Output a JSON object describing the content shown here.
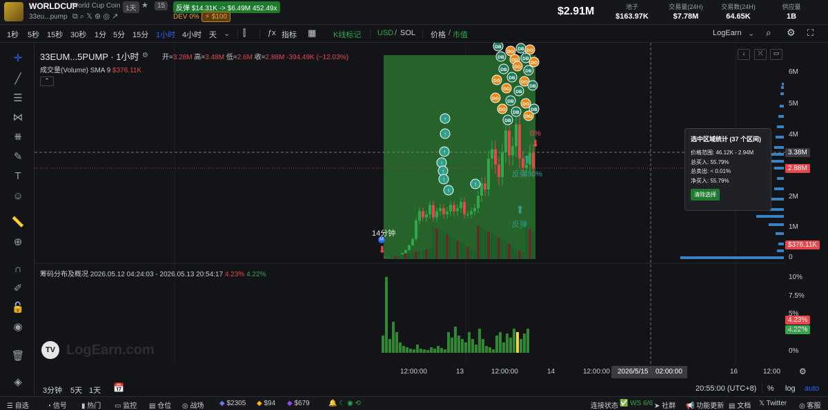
{
  "header": {
    "symbol": "WORLDCUP",
    "name": "World Cup Coin",
    "age": "1天",
    "star_count": "15",
    "address": "33eu...pump",
    "rebound": "反弹",
    "rebound_range": "$14.31K -> $6.49M",
    "rebound_pct": "452.49x",
    "dev": "DEV 0%",
    "bounty": "$100",
    "market_cap": "$2.91M",
    "stats": [
      {
        "label": "池子",
        "value": "$163.97K"
      },
      {
        "label": "交易量(24H)",
        "value": "$7.78M"
      },
      {
        "label": "交易数(24H)",
        "value": "64.65K"
      },
      {
        "label": "供应量",
        "value": "1B"
      }
    ]
  },
  "toolbar": {
    "intervals": [
      "1秒",
      "5秒",
      "15秒",
      "30秒",
      "1分",
      "5分",
      "15分",
      "1小时",
      "4小时",
      "天"
    ],
    "active_interval": "1小时",
    "indicators": "指标",
    "kline_mark": "K线标记",
    "usd": "USD",
    "sol": "SOL",
    "price": "价格",
    "mcap": "市值",
    "logearn": "LogEarn"
  },
  "legend": {
    "title": "33EUM...5PUMP · 1小时",
    "open_label": "开=",
    "open": "3.28M",
    "high_label": "高=",
    "high": "3.48M",
    "low_label": "低=",
    "low": "2.6M",
    "close_label": "收=",
    "close": "2.88M",
    "change": "-394.49K (−12.03%)",
    "volume": "成交量(Volume) SMA 9",
    "volume_value": "$376.11K",
    "chips": "筹码分布及概况 2026.05.12 04:24:03 - 2026.05.13 20:54:17",
    "chips_red": "4.23%",
    "chips_green": "4.22%"
  },
  "markers": {
    "m14": "14分钟",
    "m": "M",
    "rebound": "反弹",
    "rebound30": "反弹30%",
    "red_pct": "0%"
  },
  "popup": {
    "title": "选中区域统计 (37 个区间)",
    "range": "价格范围: 46.12K - 2.94M",
    "buy": "总买入: 55.79%",
    "sell": "总卖出: < 0.01%",
    "net": "净买入: 55.79%",
    "clear": "清除选择"
  },
  "yaxis": {
    "top_labels": [
      "6M",
      "5M",
      "4M",
      "2M",
      "1M",
      "0"
    ],
    "badge_3": "3.38M",
    "badge_2": "2.88M",
    "badge_vol": "$376.11K",
    "bottom_labels": [
      "10%",
      "7.5%",
      "5%",
      "2.5%",
      "0%"
    ],
    "badge_red": "4.23%",
    "badge_green": "4.22%"
  },
  "xaxis": {
    "labels": [
      "12:00:00",
      "13",
      "12:00:00",
      "14",
      "12:00:00",
      "16",
      "12:00"
    ],
    "crosshair": "2026/5/15",
    "crosshair_time": "02:00:00"
  },
  "bottombar": {
    "ranges": [
      "3分钟",
      "5天",
      "1天"
    ],
    "clock": "20:55:00 (UTC+8)",
    "pct": "%",
    "log": "log",
    "auto": "auto"
  },
  "watermark": "LogEarn.com",
  "footer": {
    "left": [
      "自选",
      "信号",
      "热门",
      "监控",
      "仓位",
      "战场"
    ],
    "eth": "$2305",
    "bnb": "$94",
    "sol": "$679",
    "conn": "连接状态",
    "ws": "WS 6/6",
    "community": "社群",
    "update": "功能更新",
    "docs": "文档",
    "twitter": "Twitter",
    "support": "客服"
  },
  "colors": {
    "up": "#2fa84a",
    "down": "#e8464b",
    "accent": "#2962ff",
    "selection": "#2e7d32"
  }
}
